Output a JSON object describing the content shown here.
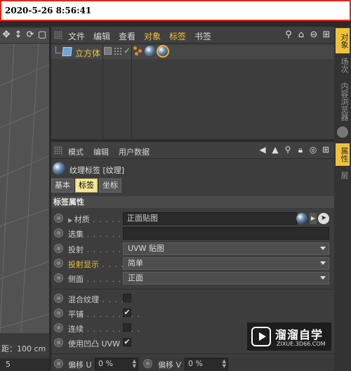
{
  "timestamp": "2020-5-26 8:56:41",
  "viewport": {
    "status": "距：100 cm",
    "bottom_value": "5"
  },
  "object_manager": {
    "menu": [
      "文件",
      "编辑",
      "查看",
      "对象",
      "标签",
      "书签"
    ],
    "object_name": "立方体"
  },
  "attribute_manager": {
    "menu": [
      "模式",
      "编辑",
      "用户数据"
    ],
    "tag_title": "纹理标签 [纹理]",
    "tabs": [
      "基本",
      "标签",
      "坐标"
    ],
    "section": "标签属性",
    "fields": {
      "material_label": "材质",
      "material_dots": " . . . . . . . ",
      "material_value": "正面贴图",
      "selection_label": "选集",
      "selection_dots": " . . . . . . . ",
      "projection_label": "投射",
      "projection_dots": " . . . . . . . . . ",
      "projection_value": "UVW 贴图",
      "projection_display_label": "投射显示",
      "projection_display_dots": " . . . . . . ",
      "projection_display_value": "简单",
      "side_label": "侧面",
      "side_dots": " . . . . . . . . . ",
      "side_value": "正面",
      "mix_label": "混合纹理",
      "mix_dots": " . . . . . ",
      "tile_label": "平铺",
      "tile_dots": " . . . . . . . . . ",
      "tile_check": "✔",
      "seamless_label": "连续",
      "seamless_dots": " . . . . . . . . . ",
      "bump_label": "使用凹凸 UVW",
      "bump_check": "✔",
      "offset_u_label": "偏移 U",
      "offset_u_value": "0 %",
      "offset_v_label": "偏移 V",
      "offset_v_value": "0 %"
    }
  },
  "right_tabs": [
    "对象",
    "场次",
    "内容浏览器",
    "属性",
    "层"
  ],
  "watermark": {
    "cn": "溜溜自学",
    "en": "ZIXUE.3D66.COM"
  }
}
